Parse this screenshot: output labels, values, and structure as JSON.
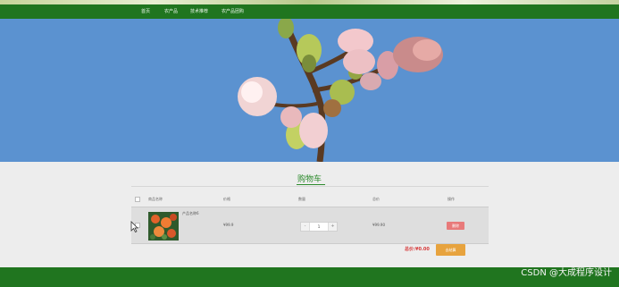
{
  "nav": {
    "items": [
      "首页",
      "农产品",
      "技术推荐",
      "农产品团购"
    ]
  },
  "cart": {
    "title": "购物车",
    "columns": [
      "商品名称",
      "价格",
      "数量",
      "总价",
      "操作"
    ],
    "items": [
      {
        "name": "产品名称6",
        "price": "¥99.9",
        "quantity": "1",
        "decrement": "-",
        "increment": "+",
        "subtotal": "¥99.90",
        "action": "删除"
      }
    ],
    "total_label": "总价:",
    "total_value": "¥0.00",
    "checkout_label": "去结算"
  },
  "watermark": "CSDN @大成程序设计",
  "colors": {
    "nav_green": "#20751f",
    "accent_green": "#2c8a2c",
    "delete_red": "#e87a7a",
    "checkout_orange": "#e7a33e",
    "price_red": "#d73a3a"
  }
}
